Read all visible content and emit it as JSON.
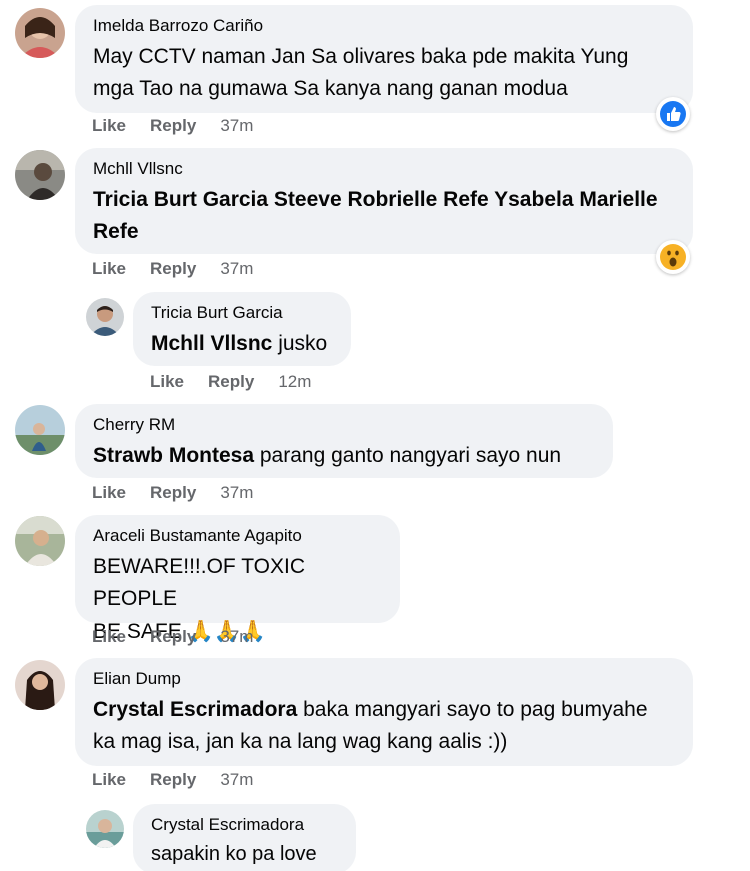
{
  "comments": [
    {
      "author": "Imelda Barrozo Cariño",
      "text": "May CCTV naman Jan Sa olivares baka pde makita Yung mga Tao na gumawa Sa kanya nang ganan modua",
      "actions": {
        "like": "Like",
        "reply": "Reply",
        "time": "37m"
      },
      "reaction": "like-icon"
    },
    {
      "author": "Mchll Vllsnc",
      "text": "Tricia Burt Garcia Steeve Robrielle Refe Ysabela Marielle Refe",
      "actions": {
        "like": "Like",
        "reply": "Reply",
        "time": "37m"
      },
      "reaction": "wow-icon"
    },
    {
      "author": "Tricia Burt Garcia",
      "mention": "Mchll Vllsnc",
      "text": " jusko",
      "actions": {
        "like": "Like",
        "reply": "Reply",
        "time": "12m"
      }
    },
    {
      "author": "Cherry RM",
      "mention": "Strawb Montesa",
      "text": " parang ganto nangyari sayo nun",
      "actions": {
        "like": "Like",
        "reply": "Reply",
        "time": "37m"
      }
    },
    {
      "author": "Araceli Bustamante Agapito",
      "line1": "BEWARE!!!.OF TOXIC PEOPLE",
      "line2": "BE SAFE ",
      "emoji": "🙏🙏🙏",
      "actions": {
        "like": "Like",
        "reply": "Reply",
        "time": "37m"
      }
    },
    {
      "author": "Elian Dump",
      "mention": "Crystal Escrimadora",
      "text": " baka mangyari sayo to pag bumyahe ka mag isa, jan ka na lang wag kang aalis :))",
      "actions": {
        "like": "Like",
        "reply": "Reply",
        "time": "37m"
      }
    },
    {
      "author": "Crystal Escrimadora",
      "text": "sapakin ko pa love"
    }
  ],
  "colors": {
    "bubble": "#f0f2f5",
    "action_text": "#65676b",
    "like_blue": "#1877f2",
    "wow_yellow": "#f7b125"
  }
}
